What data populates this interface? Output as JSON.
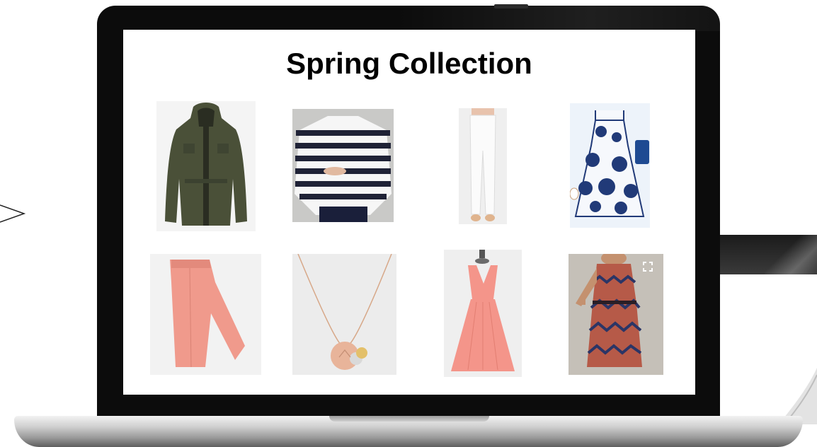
{
  "page": {
    "title": "Spring Collection"
  },
  "products": [
    {
      "name": "olive-utility-jacket",
      "color": "#4a5038"
    },
    {
      "name": "striped-breton-top",
      "color": "#1f2236"
    },
    {
      "name": "white-skinny-jeans",
      "color": "#f4f4f4"
    },
    {
      "name": "navy-floral-dress",
      "color": "#213a78"
    },
    {
      "name": "coral-skinny-jeans",
      "color": "#f09a8c"
    },
    {
      "name": "rose-gold-charm-necklace",
      "color": "#e8b49a"
    },
    {
      "name": "coral-pleated-dress",
      "color": "#f4958a"
    },
    {
      "name": "printed-chevron-dress",
      "color": "#b65a48"
    }
  ],
  "colors": {
    "bezel": "#0c0c0c",
    "screen": "#ffffff",
    "title": "#000000"
  }
}
